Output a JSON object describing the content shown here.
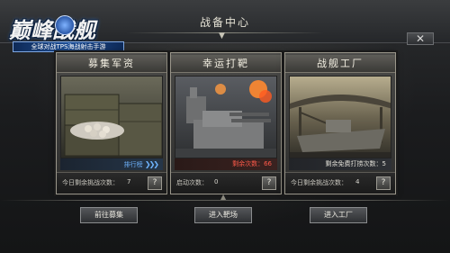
{
  "header": {
    "title": "战备中心",
    "close_label": "✕"
  },
  "logo": {
    "main_text": "巅峰战舰",
    "sub_text": "全球对战TPS海战射击手游"
  },
  "cards": [
    {
      "title": "募集军资",
      "strip_label": "排行榜",
      "foot_label": "今日剩余挑战次数：",
      "foot_value": "7",
      "help": "?",
      "button": "前往募集"
    },
    {
      "title": "幸运打靶",
      "strip_label": "剩余次数：66",
      "foot_label": "启动次数：",
      "foot_value": "0",
      "help": "?",
      "button": "进入靶场"
    },
    {
      "title": "战舰工厂",
      "strip_label": "剩余免费打捞次数：5",
      "foot_label": "今日剩余挑战次数：",
      "foot_value": "4",
      "help": "?",
      "button": "进入工厂"
    }
  ],
  "colors": {
    "accent_blue": "#6fb4ff",
    "target_red": "#ff5a4a",
    "frame": "#9a968a"
  }
}
